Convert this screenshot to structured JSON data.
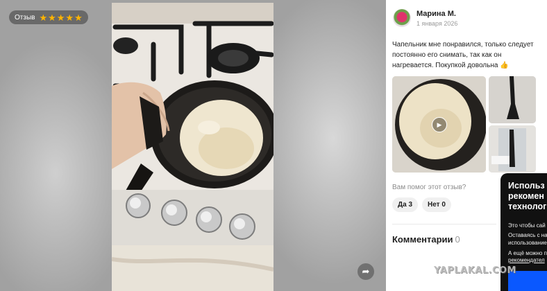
{
  "viewer": {
    "rating_label": "Отзыв",
    "stars": 5,
    "star_color": "#ffb400",
    "share_icon": "share-icon"
  },
  "review": {
    "author_name": "Марина М.",
    "date": "1 января 2026",
    "text_line1": "Чапельник мне понравился, только следует",
    "text_line2": "постоянно его снимать, так как он",
    "text_line3": "нагревается. Покупкой довольна 👍",
    "helpful_question": "Вам помог этот отзыв?",
    "vote_yes": "Да 3",
    "vote_no": "Нет 0",
    "comments_label": "Комментарии",
    "comments_count": "0"
  },
  "popup": {
    "title": "Использ\nрекомен\nтехнолог",
    "line1": "Это чтобы сай",
    "line2": "Оставаясь с на",
    "line3": "использование",
    "line4": "А ещё можно п",
    "link": "рекомендател",
    "button_color": "#0a58ff"
  },
  "watermark": "YAPLAKAL.COM"
}
